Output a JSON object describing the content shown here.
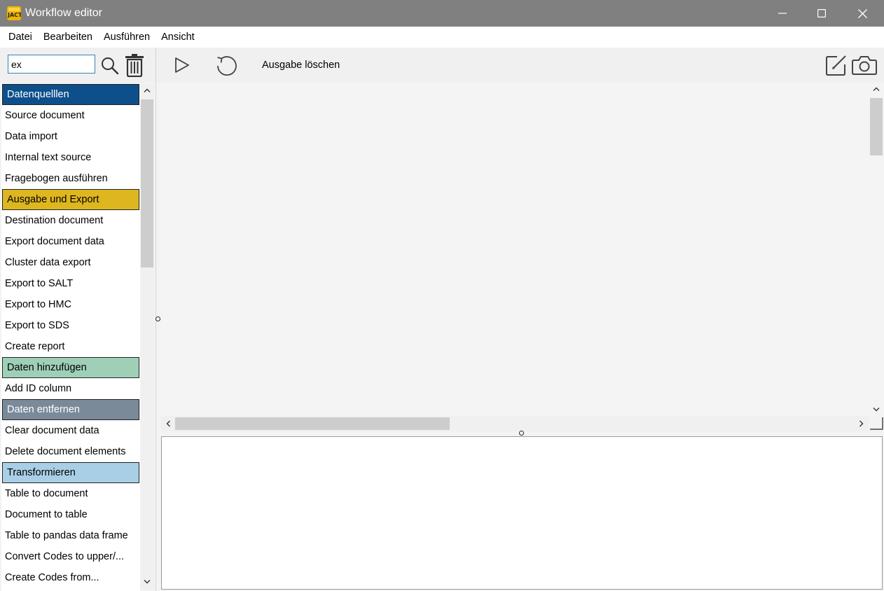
{
  "window": {
    "title": "Workflow editor",
    "icon_text": "JACT"
  },
  "menu": {
    "items": [
      "Datei",
      "Bearbeiten",
      "Ausführen",
      "Ansicht"
    ]
  },
  "search": {
    "value": "ex",
    "placeholder": ""
  },
  "toolbar": {
    "clear_output_label": "Ausgabe löschen"
  },
  "tool_list": [
    {
      "label": "Datenquelllen",
      "category": true,
      "color": "#0d4f8b"
    },
    {
      "label": "Source document"
    },
    {
      "label": "Data import"
    },
    {
      "label": "Internal text source"
    },
    {
      "label": "Fragebogen ausführen"
    },
    {
      "label": "Ausgabe und Export",
      "category": true,
      "color": "#deb61f"
    },
    {
      "label": "Destination document"
    },
    {
      "label": "Export document data"
    },
    {
      "label": "Cluster data export"
    },
    {
      "label": "Export to SALT"
    },
    {
      "label": "Export to HMC"
    },
    {
      "label": "Export to SDS"
    },
    {
      "label": "Create report"
    },
    {
      "label": "Daten hinzufügen",
      "category": true,
      "color": "#9fd0b7"
    },
    {
      "label": "Add ID column"
    },
    {
      "label": "Daten entfernen",
      "category": true,
      "color": "#7a8a99"
    },
    {
      "label": "Clear document data"
    },
    {
      "label": "Delete document elements"
    },
    {
      "label": "Transformieren",
      "category": true,
      "color": "#a9cfe6"
    },
    {
      "label": "Table to document"
    },
    {
      "label": "Document to table"
    },
    {
      "label": "Table to pandas data frame"
    },
    {
      "label": "Convert Codes to upper/..."
    },
    {
      "label": "Create Codes from..."
    }
  ],
  "icons": {
    "search": "search-icon",
    "trash": "trash-icon",
    "play": "play-icon",
    "reset": "reset-icon",
    "edit": "edit-icon",
    "camera": "camera-icon"
  }
}
